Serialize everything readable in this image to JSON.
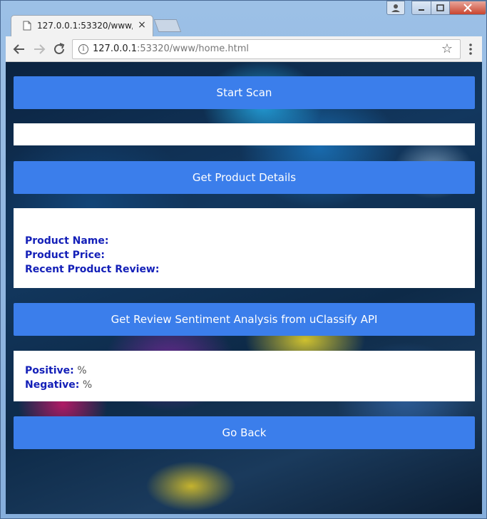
{
  "browser": {
    "tab": {
      "title": "127.0.0.1:53320/www/ho",
      "close": "×"
    },
    "url": {
      "host": "127.0.0.1",
      "rest": ":53320/www/home.html"
    }
  },
  "page": {
    "start_scan_label": "Start Scan",
    "scan_input_value": "",
    "get_details_label": "Get Product Details",
    "product": {
      "name_label": "Product Name:",
      "name_value": "",
      "price_label": "Product Price:",
      "price_value": "",
      "review_label": "Recent Product Review:",
      "review_value": ""
    },
    "sentiment_button_label": "Get Review Sentiment Analysis from uClassify API",
    "sentiment": {
      "positive_label": "Positive:",
      "positive_value": "",
      "positive_unit": "%",
      "negative_label": "Negative:",
      "negative_value": "",
      "negative_unit": "%"
    },
    "go_back_label": "Go Back"
  },
  "icons": [
    "page-favicon-icon",
    "close-icon",
    "user-icon",
    "minimize-icon",
    "maximize-icon",
    "window-close-icon",
    "back-arrow-icon",
    "forward-arrow-icon",
    "reload-icon",
    "info-icon",
    "star-icon",
    "menu-icon"
  ],
  "colors": {
    "button": "#3b7eeb",
    "label": "#1420b8"
  }
}
